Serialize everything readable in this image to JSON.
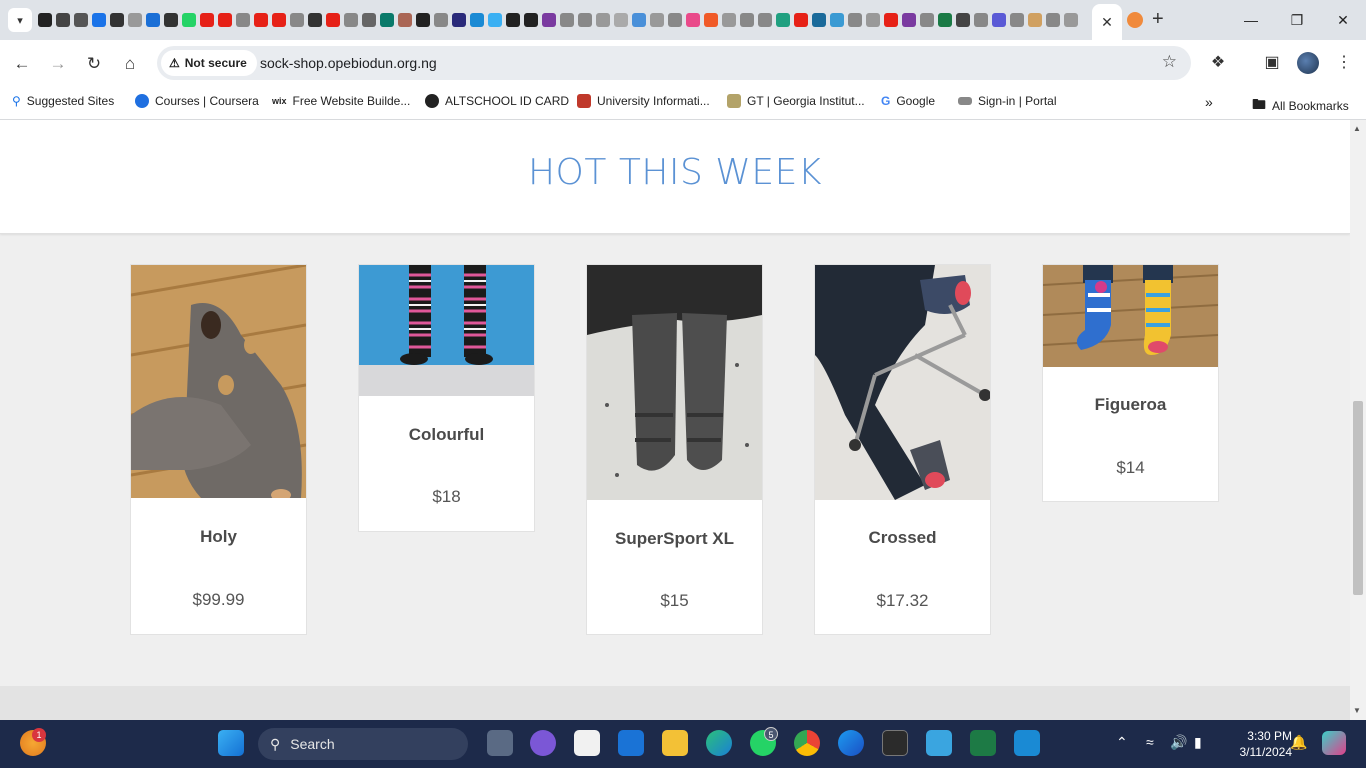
{
  "browser": {
    "address": {
      "security_label": "Not secure",
      "url": "sock-shop.opebiodun.org.ng"
    },
    "bookmarks": [
      {
        "label": "Suggested Sites",
        "icon": "search-icon"
      },
      {
        "label": "Courses | Coursera",
        "icon": "coursera-icon"
      },
      {
        "label": "Free Website Builde...",
        "icon": "wix-icon"
      },
      {
        "label": "ALTSCHOOL ID CARD",
        "icon": "altschool-icon"
      },
      {
        "label": "University Informati...",
        "icon": "university-icon"
      },
      {
        "label": "GT | Georgia Institut...",
        "icon": "georgia-tech-icon"
      },
      {
        "label": "Google",
        "icon": "google-icon"
      },
      {
        "label": "Sign-in | Portal",
        "icon": "portal-icon"
      }
    ],
    "all_bookmarks_label": "All Bookmarks"
  },
  "page": {
    "section_title": "HOT THIS WEEK",
    "products": [
      {
        "name": "Holy",
        "price": "$99.99"
      },
      {
        "name": "Colourful",
        "price": "$18"
      },
      {
        "name": "SuperSport XL",
        "price": "$15"
      },
      {
        "name": "Crossed",
        "price": "$17.32"
      },
      {
        "name": "Figueroa",
        "price": "$14"
      }
    ]
  },
  "taskbar": {
    "search_placeholder": "Search",
    "weather_badge": "1",
    "whatsapp_badge": "5",
    "time": "3:30 PM",
    "date": "3/11/2024"
  },
  "colors": {
    "accent": "#5b92d4",
    "page_bg": "#efefef"
  }
}
